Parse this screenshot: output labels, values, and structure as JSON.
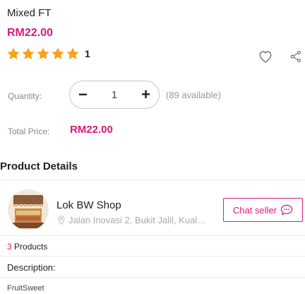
{
  "product": {
    "name": "Mixed FT",
    "price": "RM22.00",
    "rating_count": "1",
    "star_count": 5,
    "star_color": "#f7a21b"
  },
  "quantity": {
    "label": "Quantity:",
    "minus": "−",
    "value": "1",
    "plus": "+",
    "available": "(89 available)"
  },
  "total": {
    "label": "Total Price:",
    "value": "RM22.00"
  },
  "details": {
    "title": "Product Details"
  },
  "shop": {
    "name": "Lok BW Shop",
    "address": "Jalan Inovasi 2, Bukit Jalil, Kual…",
    "chat_label": "Chat seller",
    "product_count": "3",
    "products_label": "Products"
  },
  "description": {
    "label": "Description:",
    "text": "FruitSweet"
  },
  "colors": {
    "accent": "#d81b7d",
    "muted": "#888888"
  },
  "icons": [
    "star-icon",
    "heart-icon",
    "share-icon",
    "location-pin-icon",
    "chat-bubble-icon"
  ]
}
